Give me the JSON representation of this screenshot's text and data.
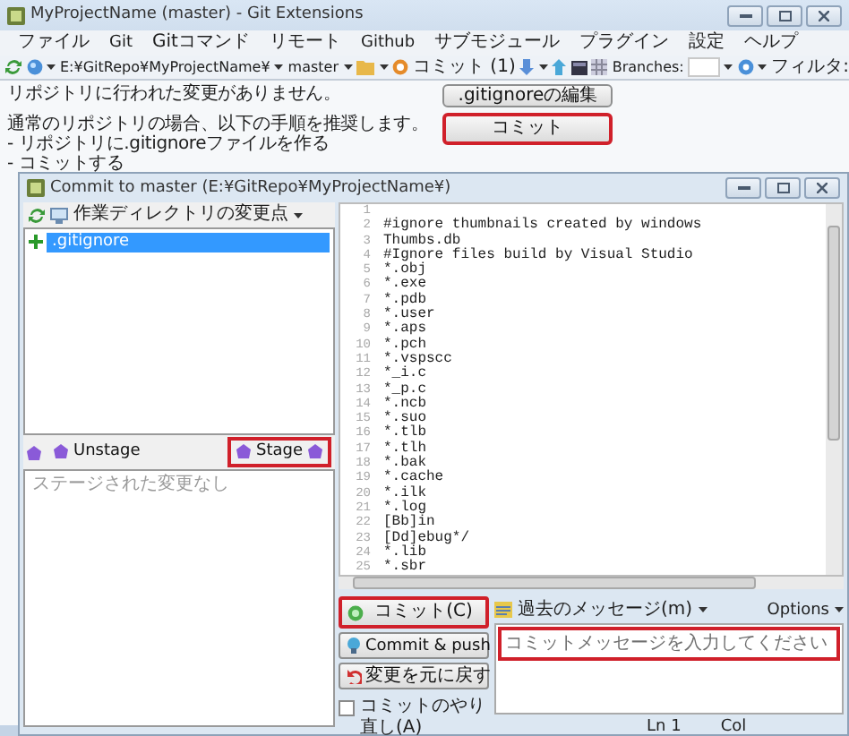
{
  "main_window": {
    "title": "MyProjectName (master) - Git Extensions",
    "menu": [
      "ファイル",
      "Git",
      "Gitコマンド",
      "リモート",
      "Github",
      "サブモジュール",
      "プラグイン",
      "設定",
      "ヘルプ"
    ],
    "toolbar": {
      "repo_path": "E:¥GitRepo¥MyProjectName¥",
      "branch": "master",
      "commit": "コミット (1)",
      "branches_label": "Branches:",
      "filter_label": "フィルタ:"
    },
    "info_lines": [
      "リポジトリに行われた変更がありません。",
      "通常のリポジトリの場合、以下の手順を推奨します。",
      "- リポジトリに.gitignoreファイルを作る",
      "- コミットする"
    ],
    "buttons": [
      {
        "label": ".gitignoreの編集",
        "highlighted": false
      },
      {
        "label": "コミット",
        "highlighted": true
      }
    ]
  },
  "commit_dialog": {
    "title": "Commit to master (E:¥GitRepo¥MyProjectName¥)",
    "changes_menu": "作業ディレクトリの変更点",
    "unstaged_files": [
      {
        "name": ".gitignore",
        "selected": true
      }
    ],
    "unstage_button": {
      "label": "Unstage",
      "highlighted": false
    },
    "stage_button": {
      "label": "Stage",
      "highlighted": true
    },
    "staged_placeholder": "ステージされた変更なし",
    "diff_lines": [
      {
        "number": "1"
      },
      {
        "number": "2",
        "text": "#ignore thumbnails created by windows"
      },
      {
        "number": "3",
        "text": "Thumbs.db"
      },
      {
        "number": "4",
        "text": "#Ignore files build by Visual Studio"
      },
      {
        "number": "5",
        "text": "*.obj"
      },
      {
        "number": "6",
        "text": "*.exe"
      },
      {
        "number": "7",
        "text": "*.pdb"
      },
      {
        "number": "8",
        "text": "*.user"
      },
      {
        "number": "9",
        "text": "*.aps"
      },
      {
        "number": "10",
        "text": "*.pch"
      },
      {
        "number": "11",
        "text": "*.vspscc"
      },
      {
        "number": "12",
        "text": "*_i.c"
      },
      {
        "number": "13",
        "text": "*_p.c"
      },
      {
        "number": "14",
        "text": "*.ncb"
      },
      {
        "number": "15",
        "text": "*.suo"
      },
      {
        "number": "16",
        "text": "*.tlb"
      },
      {
        "number": "17",
        "text": "*.tlh"
      },
      {
        "number": "18",
        "text": "*.bak"
      },
      {
        "number": "19",
        "text": "*.cache"
      },
      {
        "number": "20",
        "text": "*.ilk"
      },
      {
        "number": "21",
        "text": "*.log"
      },
      {
        "number": "22",
        "text": "[Bb]in"
      },
      {
        "number": "23",
        "text": "[Dd]ebug*/"
      },
      {
        "number": "24",
        "text": "*.lib"
      },
      {
        "number": "25",
        "text": "*.sbr"
      }
    ],
    "action_buttons": [
      {
        "kind": "commit",
        "label": "コミット(C)",
        "highlighted": true
      },
      {
        "kind": "push",
        "label": "Commit & push",
        "highlighted": false
      },
      {
        "kind": "revert",
        "label": "変更を元に戻す",
        "highlighted": false
      }
    ],
    "amend": {
      "label": "コミットのやり直し(A)",
      "checked": false
    },
    "message": {
      "history_menu": "過去のメッセージ(m)",
      "options_menu": "Options",
      "placeholder": "コミットメッセージを入力してください",
      "highlighted": true
    },
    "status": {
      "line": "Ln 1",
      "column": "Col"
    }
  }
}
